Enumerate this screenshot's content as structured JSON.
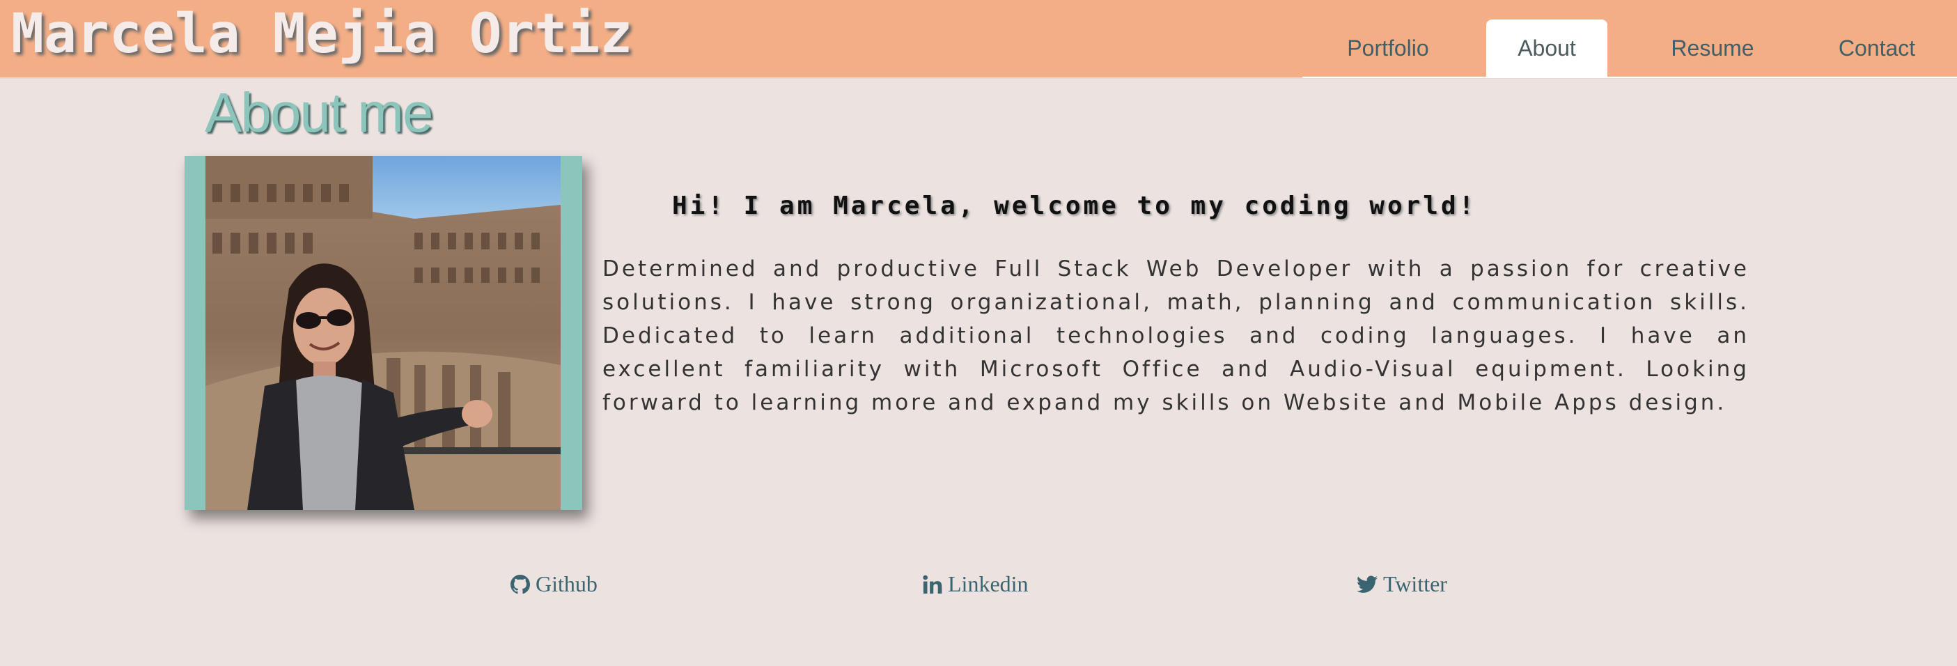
{
  "header": {
    "site_title": "Marcela Mejia Ortiz",
    "nav": [
      {
        "label": "Portfolio",
        "active": false
      },
      {
        "label": "About",
        "active": true
      },
      {
        "label": "Resume",
        "active": false
      },
      {
        "label": "Contact",
        "active": false
      }
    ]
  },
  "about": {
    "heading": "About me",
    "greeting": "Hi! I am Marcela, welcome to my coding world!",
    "bio": "Determined and productive Full Stack Web Developer with a passion for creative solutions. I have strong organizational, math, planning and communication skills. Dedicated to learn additional technologies and coding languages. I have an excellent familiarity with Microsoft Office and Audio-Visual equipment. Looking forward to learning more and expand my skills on Website and Mobile Apps design."
  },
  "social": [
    {
      "label": "Github",
      "icon": "github-icon"
    },
    {
      "label": "Linkedin",
      "icon": "linkedin-icon"
    },
    {
      "label": "Twitter",
      "icon": "twitter-icon"
    }
  ],
  "colors": {
    "header_bg": "#f3ae86",
    "page_bg": "#ece2e0",
    "accent_teal": "#8cc5bb",
    "link_color": "#3a6470"
  }
}
